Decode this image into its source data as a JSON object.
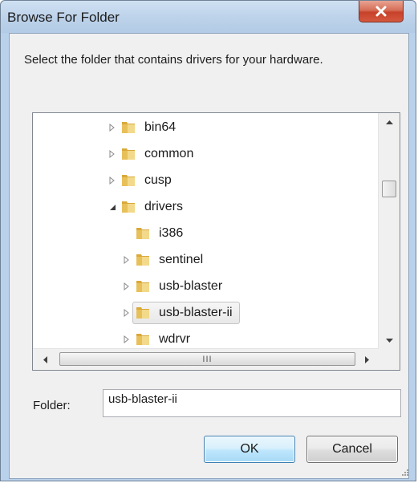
{
  "window": {
    "title": "Browse For Folder",
    "close_icon": "close-icon"
  },
  "description": "Select the folder that contains drivers for your hardware.",
  "tree": {
    "items": [
      {
        "label": "bin64",
        "level": 0,
        "expander": "collapsed",
        "selected": false
      },
      {
        "label": "common",
        "level": 0,
        "expander": "collapsed",
        "selected": false
      },
      {
        "label": "cusp",
        "level": 0,
        "expander": "collapsed",
        "selected": false
      },
      {
        "label": "drivers",
        "level": 0,
        "expander": "expanded",
        "selected": false
      },
      {
        "label": "i386",
        "level": 1,
        "expander": "none",
        "selected": false
      },
      {
        "label": "sentinel",
        "level": 1,
        "expander": "collapsed",
        "selected": false
      },
      {
        "label": "usb-blaster",
        "level": 1,
        "expander": "collapsed",
        "selected": false
      },
      {
        "label": "usb-blaster-ii",
        "level": 1,
        "expander": "collapsed",
        "selected": true
      },
      {
        "label": "wdrvr",
        "level": 1,
        "expander": "collapsed",
        "selected": false
      }
    ],
    "hscroll_grip": "III"
  },
  "folder": {
    "label": "Folder:",
    "value": "usb-blaster-ii"
  },
  "buttons": {
    "ok": "OK",
    "cancel": "Cancel"
  },
  "colors": {
    "title_bar": "#bcd2ea",
    "close_button": "#c8412a",
    "default_button_border": "#3c7fb1",
    "folder_icon": "#e8c05a"
  }
}
